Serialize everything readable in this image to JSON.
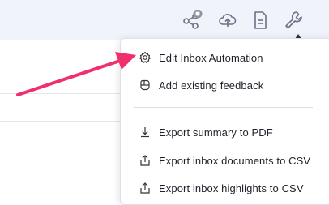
{
  "toolbar": {
    "icons": [
      "share-icon",
      "cloud-upload-icon",
      "document-icon",
      "wrench-icon"
    ]
  },
  "menu": {
    "items": [
      {
        "label": "Edit Inbox Automation",
        "icon": "gear-icon"
      },
      {
        "label": "Add existing feedback",
        "icon": "feedback-icon"
      },
      {
        "label": "Export summary to PDF",
        "icon": "download-icon"
      },
      {
        "label": "Export inbox documents to CSV",
        "icon": "export-icon"
      },
      {
        "label": "Export inbox highlights to CSV",
        "icon": "export-icon"
      }
    ]
  },
  "colors": {
    "topbar_bg": "#f1f3fa",
    "icon": "#6a7283",
    "menu_text": "#1d2128",
    "arrow": "#f0306c"
  }
}
